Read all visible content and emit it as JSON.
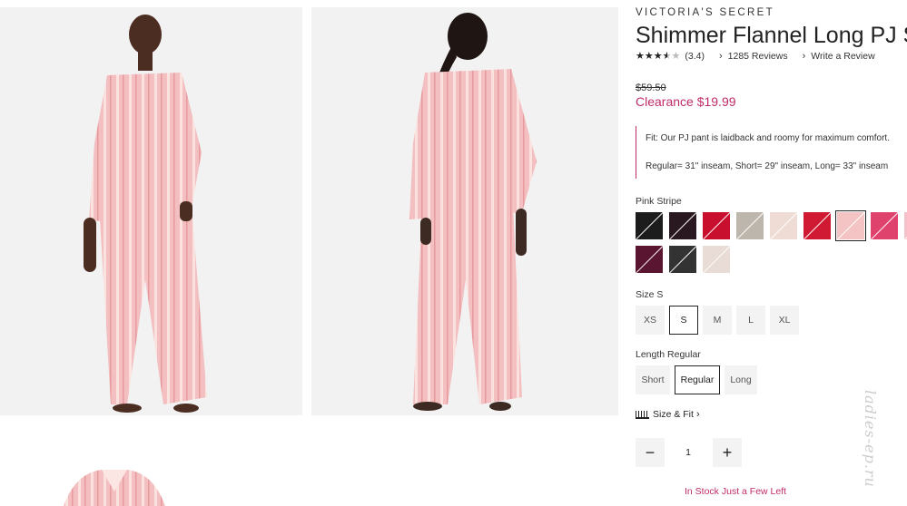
{
  "product": {
    "brand": "VICTORIA'S SECRET",
    "title": "Shimmer Flannel Long PJ Set",
    "rating": {
      "value": 3.4,
      "display": "(3.4)",
      "max": 5
    },
    "reviews_link": "1285 Reviews",
    "write_review_link": "Write a Review",
    "original_price": "$59.50",
    "sale_price": "Clearance $19.99",
    "fit_note_line1": "Fit: Our PJ pant is laidback and roomy for maximum comfort.",
    "fit_note_line2": "Regular= 31\" inseam, Short= 29\" inseam, Long= 33\" inseam"
  },
  "color": {
    "label": "Pink Stripe",
    "swatches": [
      {
        "name": "black-multi-swatch",
        "color": "#1c1c1c"
      },
      {
        "name": "black-pink-swatch",
        "color": "#2a1820"
      },
      {
        "name": "red-swatch",
        "color": "#c8102e"
      },
      {
        "name": "leopard-swatch",
        "color": "#bdb6ad"
      },
      {
        "name": "blush-swatch",
        "color": "#efddd5"
      },
      {
        "name": "red-stripe-swatch",
        "color": "#d01a34"
      },
      {
        "name": "pink-stripe-swatch",
        "color": "#f4c4c4",
        "selected": true
      },
      {
        "name": "pink-plaid-swatch",
        "color": "#e0426e"
      },
      {
        "name": "pink-mini-swatch",
        "color": "#f3c1c9"
      },
      {
        "name": "burgundy-plaid-swatch",
        "color": "#5a1530"
      },
      {
        "name": "black-white-plaid-swatch",
        "color": "#333333"
      },
      {
        "name": "cream-plaid-swatch",
        "color": "#e9dcd6"
      }
    ]
  },
  "size": {
    "label": "Size S",
    "options": [
      "XS",
      "S",
      "M",
      "L",
      "XL"
    ],
    "selected": "S"
  },
  "length": {
    "label": "Length Regular",
    "options": [
      "Short",
      "Regular",
      "Long"
    ],
    "selected": "Regular"
  },
  "size_fit_link": "Size & Fit",
  "quantity": {
    "minus": "−",
    "value": "1",
    "plus": "+"
  },
  "stock_status": "In Stock Just a Few Left",
  "watermark": "ladies-ep.ru",
  "accent_color": "#c02c6a"
}
